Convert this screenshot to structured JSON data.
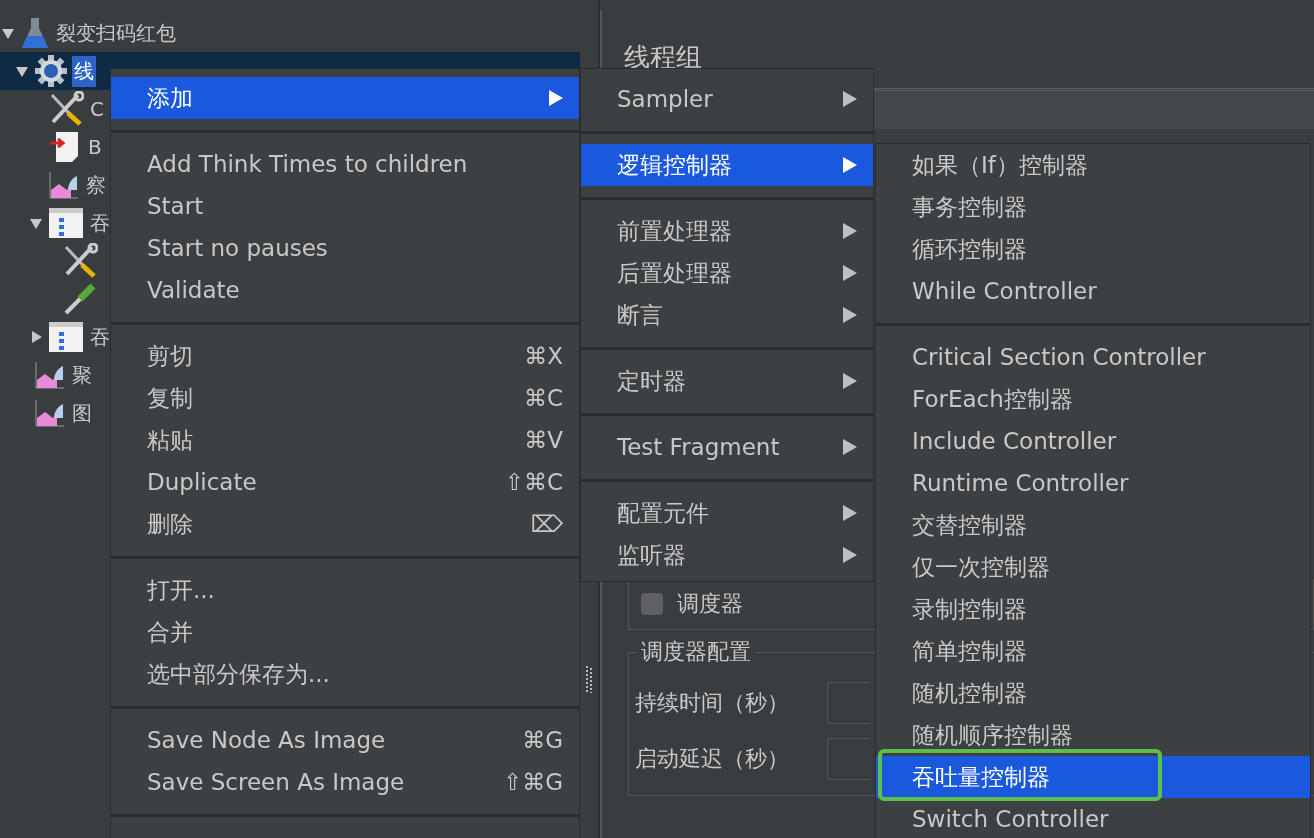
{
  "tree": {
    "items": [
      {
        "label": "裂变扫码红包",
        "kind": "flask",
        "expanded": true,
        "selected": false,
        "children": [
          {
            "label": "线",
            "kind": "gear",
            "expanded": true,
            "selected": true,
            "children": [
              {
                "label": "C",
                "kind": "tools",
                "selected": false
              },
              {
                "label": "B",
                "kind": "http",
                "selected": false
              },
              {
                "label": "察",
                "kind": "listener",
                "selected": false
              },
              {
                "label": "吞",
                "kind": "controller",
                "expanded": true,
                "selected": false,
                "children": [
                  {
                    "kind": "tools",
                    "selected": false
                  },
                  {
                    "kind": "pipette",
                    "selected": false
                  }
                ]
              },
              {
                "label": "吞",
                "kind": "controller",
                "expanded": false,
                "selected": false
              }
            ]
          },
          {
            "label": "聚",
            "kind": "listener",
            "selected": false
          },
          {
            "label": "图",
            "kind": "listener",
            "selected": false
          }
        ]
      }
    ]
  },
  "panel": {
    "title": "线程组",
    "scheduler": {
      "label": "调度器",
      "checked": false
    },
    "scheduler_config": {
      "title": "调度器配置",
      "fields": [
        {
          "label": "持续时间（秒）"
        },
        {
          "label": "启动延迟（秒）"
        }
      ]
    }
  },
  "menus": [
    {
      "items": [
        {
          "kind": "item",
          "label": "添加",
          "submenu": true,
          "selected": true
        },
        {
          "kind": "separator"
        },
        {
          "kind": "item",
          "label": "Add Think Times to children",
          "selected": false
        },
        {
          "kind": "item",
          "label": "Start",
          "selected": false
        },
        {
          "kind": "item",
          "label": "Start no pauses",
          "selected": false
        },
        {
          "kind": "item",
          "label": "Validate",
          "selected": false
        },
        {
          "kind": "separator"
        },
        {
          "kind": "item",
          "label": "剪切",
          "shortcut": "⌘X",
          "selected": false
        },
        {
          "kind": "item",
          "label": "复制",
          "shortcut": "⌘C",
          "selected": false
        },
        {
          "kind": "item",
          "label": "粘贴",
          "shortcut": "⌘V",
          "selected": false
        },
        {
          "kind": "item",
          "label": "Duplicate",
          "shortcut": "⇧⌘C",
          "selected": false
        },
        {
          "kind": "item",
          "label": "删除",
          "shortcut": "⌦",
          "selected": false
        },
        {
          "kind": "separator"
        },
        {
          "kind": "item",
          "label": "打开...",
          "selected": false
        },
        {
          "kind": "item",
          "label": "合并",
          "selected": false
        },
        {
          "kind": "item",
          "label": "选中部分保存为...",
          "selected": false
        },
        {
          "kind": "separator"
        },
        {
          "kind": "item",
          "label": "Save Node As Image",
          "shortcut": "⌘G",
          "selected": false
        },
        {
          "kind": "item",
          "label": "Save Screen As Image",
          "shortcut": "⇧⌘G",
          "selected": false
        },
        {
          "kind": "separator"
        }
      ]
    },
    {
      "items": [
        {
          "kind": "item",
          "label": "Sampler",
          "submenu": true,
          "selected": false
        },
        {
          "kind": "separator"
        },
        {
          "kind": "item",
          "label": "逻辑控制器",
          "submenu": true,
          "selected": true
        },
        {
          "kind": "separator"
        },
        {
          "kind": "item",
          "label": "前置处理器",
          "submenu": true,
          "selected": false
        },
        {
          "kind": "item",
          "label": "后置处理器",
          "submenu": true,
          "selected": false
        },
        {
          "kind": "item",
          "label": "断言",
          "submenu": true,
          "selected": false
        },
        {
          "kind": "separator"
        },
        {
          "kind": "item",
          "label": "定时器",
          "submenu": true,
          "selected": false
        },
        {
          "kind": "separator"
        },
        {
          "kind": "item",
          "label": "Test Fragment",
          "submenu": true,
          "selected": false
        },
        {
          "kind": "separator"
        },
        {
          "kind": "item",
          "label": "配置元件",
          "submenu": true,
          "selected": false
        },
        {
          "kind": "item",
          "label": "监听器",
          "submenu": true,
          "selected": false
        }
      ]
    },
    {
      "items": [
        {
          "kind": "item",
          "label": "如果（If）控制器",
          "selected": false
        },
        {
          "kind": "item",
          "label": "事务控制器",
          "selected": false
        },
        {
          "kind": "item",
          "label": "循环控制器",
          "selected": false
        },
        {
          "kind": "item",
          "label": "While Controller",
          "selected": false
        },
        {
          "kind": "separator"
        },
        {
          "kind": "item",
          "label": "Critical Section Controller",
          "selected": false
        },
        {
          "kind": "item",
          "label": "ForEach控制器",
          "selected": false
        },
        {
          "kind": "item",
          "label": "Include Controller",
          "selected": false
        },
        {
          "kind": "item",
          "label": "Runtime Controller",
          "selected": false
        },
        {
          "kind": "item",
          "label": "交替控制器",
          "selected": false
        },
        {
          "kind": "item",
          "label": "仅一次控制器",
          "selected": false
        },
        {
          "kind": "item",
          "label": "录制控制器",
          "selected": false
        },
        {
          "kind": "item",
          "label": "简单控制器",
          "selected": false
        },
        {
          "kind": "item",
          "label": "随机控制器",
          "selected": false
        },
        {
          "kind": "item",
          "label": "随机顺序控制器",
          "selected": false
        },
        {
          "kind": "item",
          "label": "吞吐量控制器",
          "selected": true,
          "framed": true
        },
        {
          "kind": "item",
          "label": "Switch Controller",
          "selected": false
        }
      ]
    }
  ]
}
